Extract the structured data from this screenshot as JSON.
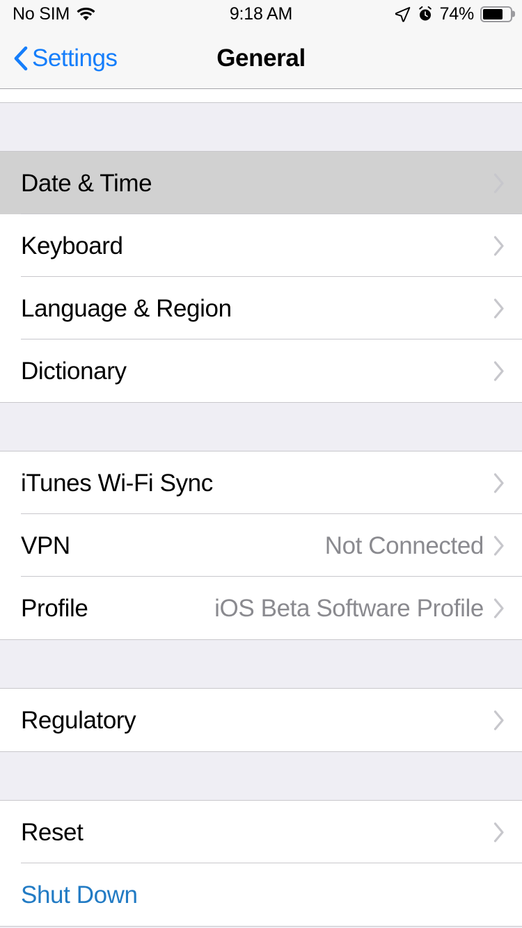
{
  "status_bar": {
    "carrier": "No SIM",
    "wifi_icon": "wifi-icon",
    "time": "9:18 AM",
    "location_icon": "location-arrow-icon",
    "alarm_icon": "alarm-clock-icon",
    "battery_percent": "74%",
    "battery_level": 74,
    "battery_icon": "battery-icon"
  },
  "nav_bar": {
    "back_icon": "chevron-left-icon",
    "back_label": "Settings",
    "title": "General"
  },
  "colors": {
    "tint_blue": "#157EFB",
    "link_blue": "#227BC4",
    "value_gray": "#8A8A8F",
    "group_background": "#EFEEF4",
    "row_background": "#FFFFFF",
    "row_pressed": "#D1D1D1",
    "separator": "#C8C7CC",
    "chevron": "#C7C7CC"
  },
  "sections": [
    {
      "rows": [
        {
          "label": "Date & Time",
          "value": "",
          "style": "default",
          "accessory": "disclosure",
          "pressed": true
        },
        {
          "label": "Keyboard",
          "value": "",
          "style": "default",
          "accessory": "disclosure",
          "pressed": false
        },
        {
          "label": "Language & Region",
          "value": "",
          "style": "default",
          "accessory": "disclosure",
          "pressed": false
        },
        {
          "label": "Dictionary",
          "value": "",
          "style": "default",
          "accessory": "disclosure",
          "pressed": false
        }
      ]
    },
    {
      "rows": [
        {
          "label": "iTunes Wi-Fi Sync",
          "value": "",
          "style": "default",
          "accessory": "disclosure",
          "pressed": false
        },
        {
          "label": "VPN",
          "value": "Not Connected",
          "style": "default",
          "accessory": "disclosure",
          "pressed": false
        },
        {
          "label": "Profile",
          "value": "iOS Beta Software Profile",
          "style": "default",
          "accessory": "disclosure",
          "pressed": false
        }
      ]
    },
    {
      "rows": [
        {
          "label": "Regulatory",
          "value": "",
          "style": "default",
          "accessory": "disclosure",
          "pressed": false
        }
      ]
    },
    {
      "rows": [
        {
          "label": "Reset",
          "value": "",
          "style": "default",
          "accessory": "disclosure",
          "pressed": false
        },
        {
          "label": "Shut Down",
          "value": "",
          "style": "tint",
          "accessory": "none",
          "pressed": false
        }
      ]
    }
  ]
}
